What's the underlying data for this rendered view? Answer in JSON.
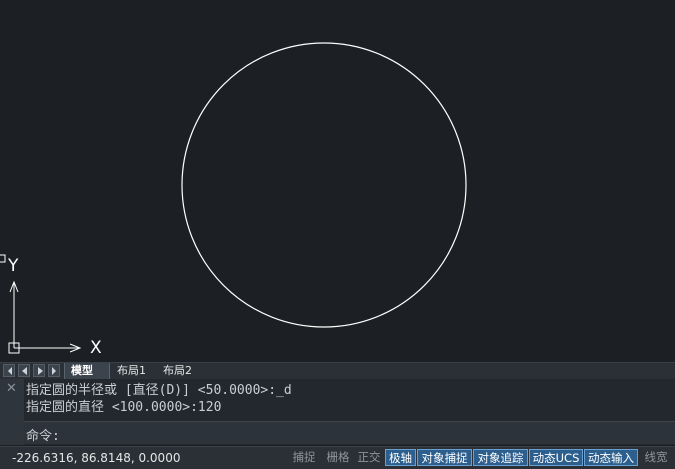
{
  "viewport": {
    "ucs_x_label": "X",
    "ucs_y_label": "Y",
    "colors": {
      "background": "#1c2025",
      "entity": "#ffffff",
      "ucs": "#ffffff"
    }
  },
  "tabs": {
    "nav_buttons": [
      "first-tab",
      "previous-tab",
      "next-tab",
      "last-tab"
    ],
    "items": [
      {
        "label": "模型",
        "active": true
      },
      {
        "label": "布局1",
        "active": false
      },
      {
        "label": "布局2",
        "active": false
      }
    ]
  },
  "command": {
    "close_icon": "close-icon",
    "history": [
      "指定圆的半径或 [直径(D)] <50.0000>:_d",
      "指定圆的直径 <100.0000>:120"
    ],
    "prompt": "命令:"
  },
  "status": {
    "coordinates": "-226.6316, 86.8148, 0.0000",
    "toggles": [
      {
        "label": "捕捉",
        "on": false
      },
      {
        "label": "栅格",
        "on": false
      },
      {
        "label": "正交",
        "on": false
      },
      {
        "label": "极轴",
        "on": true
      },
      {
        "label": "对象捕捉",
        "on": true
      },
      {
        "label": "对象追踪",
        "on": true
      },
      {
        "label": "动态UCS",
        "on": true
      },
      {
        "label": "动态输入",
        "on": true
      },
      {
        "label": "线宽",
        "on": false
      }
    ]
  }
}
